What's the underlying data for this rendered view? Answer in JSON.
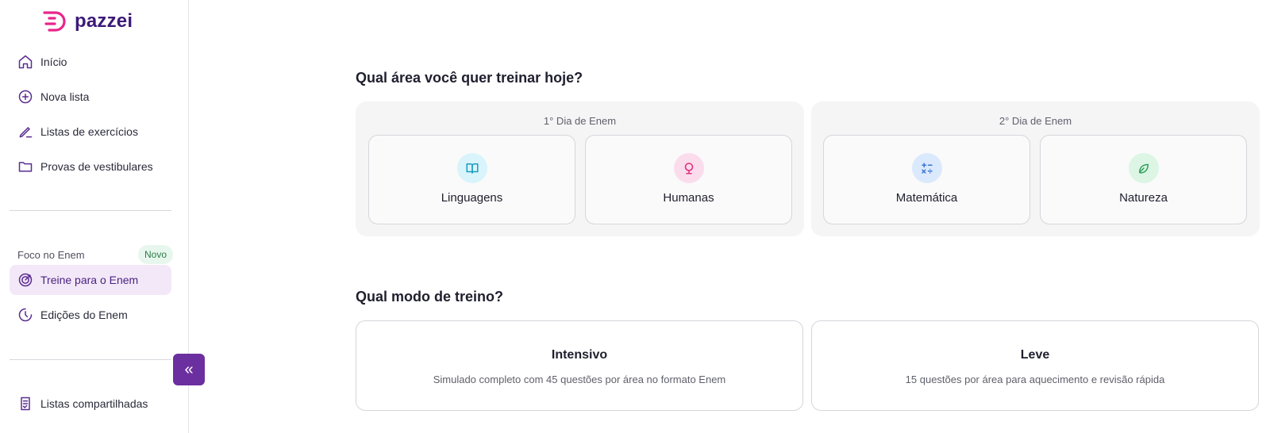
{
  "brand": {
    "name": "pazzei",
    "color": "#3c1a78",
    "icon_color": "#e8268a"
  },
  "sidebar": {
    "items": [
      {
        "label": "Início",
        "icon": "home-icon"
      },
      {
        "label": "Nova lista",
        "icon": "plus-circle-icon"
      },
      {
        "label": "Listas de exercícios",
        "icon": "pencil-icon"
      },
      {
        "label": "Provas de vestibulares",
        "icon": "folder-icon"
      }
    ],
    "section": {
      "label": "Foco no Enem",
      "badge": "Novo"
    },
    "section_items": [
      {
        "label": "Treine para o Enem",
        "icon": "target-icon",
        "active": true
      },
      {
        "label": "Edições do Enem",
        "icon": "history-icon",
        "active": false
      }
    ],
    "bottom_items": [
      {
        "label": "Listas compartilhadas",
        "icon": "shared-list-icon"
      }
    ],
    "collapse_label": "«"
  },
  "main": {
    "area_heading": "Qual área você quer treinar hoje?",
    "days": [
      {
        "label": "1° Dia de Enem",
        "areas": [
          {
            "label": "Linguagens",
            "icon": "book-icon",
            "bg": "#d9f4fa",
            "fg": "#1a9cc0"
          },
          {
            "label": "Humanas",
            "icon": "globe-icon",
            "bg": "#fbdcec",
            "fg": "#e0307e"
          }
        ]
      },
      {
        "label": "2° Dia de Enem",
        "areas": [
          {
            "label": "Matemática",
            "icon": "calculator-icon",
            "bg": "#dbe9fc",
            "fg": "#3a74d6"
          },
          {
            "label": "Natureza",
            "icon": "leaf-icon",
            "bg": "#dcf5e4",
            "fg": "#2ea05a"
          }
        ]
      }
    ],
    "mode_heading": "Qual modo de treino?",
    "modes": [
      {
        "title": "Intensivo",
        "description": "Simulado completo com 45 questões por área no formato Enem"
      },
      {
        "title": "Leve",
        "description": "15 questões por área para aquecimento e revisão rápida"
      }
    ]
  }
}
